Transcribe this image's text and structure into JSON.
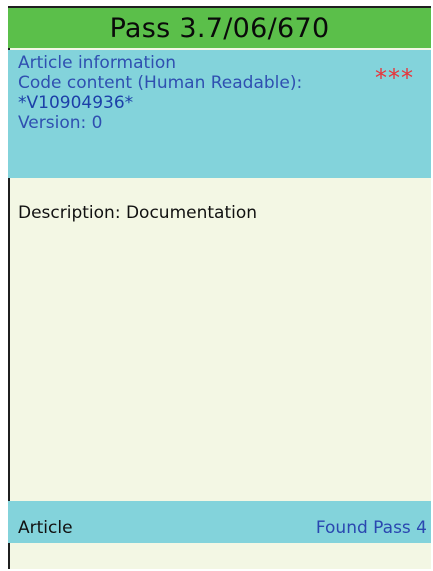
{
  "header": {
    "title": "Pass 3.7/06/670"
  },
  "info": {
    "section_label": "Article information",
    "code_content_label": "Code content (Human Readable):",
    "code_value": "*V10904936*",
    "version": "Version: 0",
    "status_marker": "***",
    "status_marker_color": "#e8343a"
  },
  "details": {
    "description_label": "Description:",
    "description_value": "Documentation"
  },
  "footer": {
    "left_label": "Article",
    "right_link": "Found Pass 4"
  },
  "colors": {
    "title_bar": "#5bbf4a",
    "panel": "#83d3db",
    "background": "#f3f7e4",
    "link_text": "#2a47b0"
  }
}
